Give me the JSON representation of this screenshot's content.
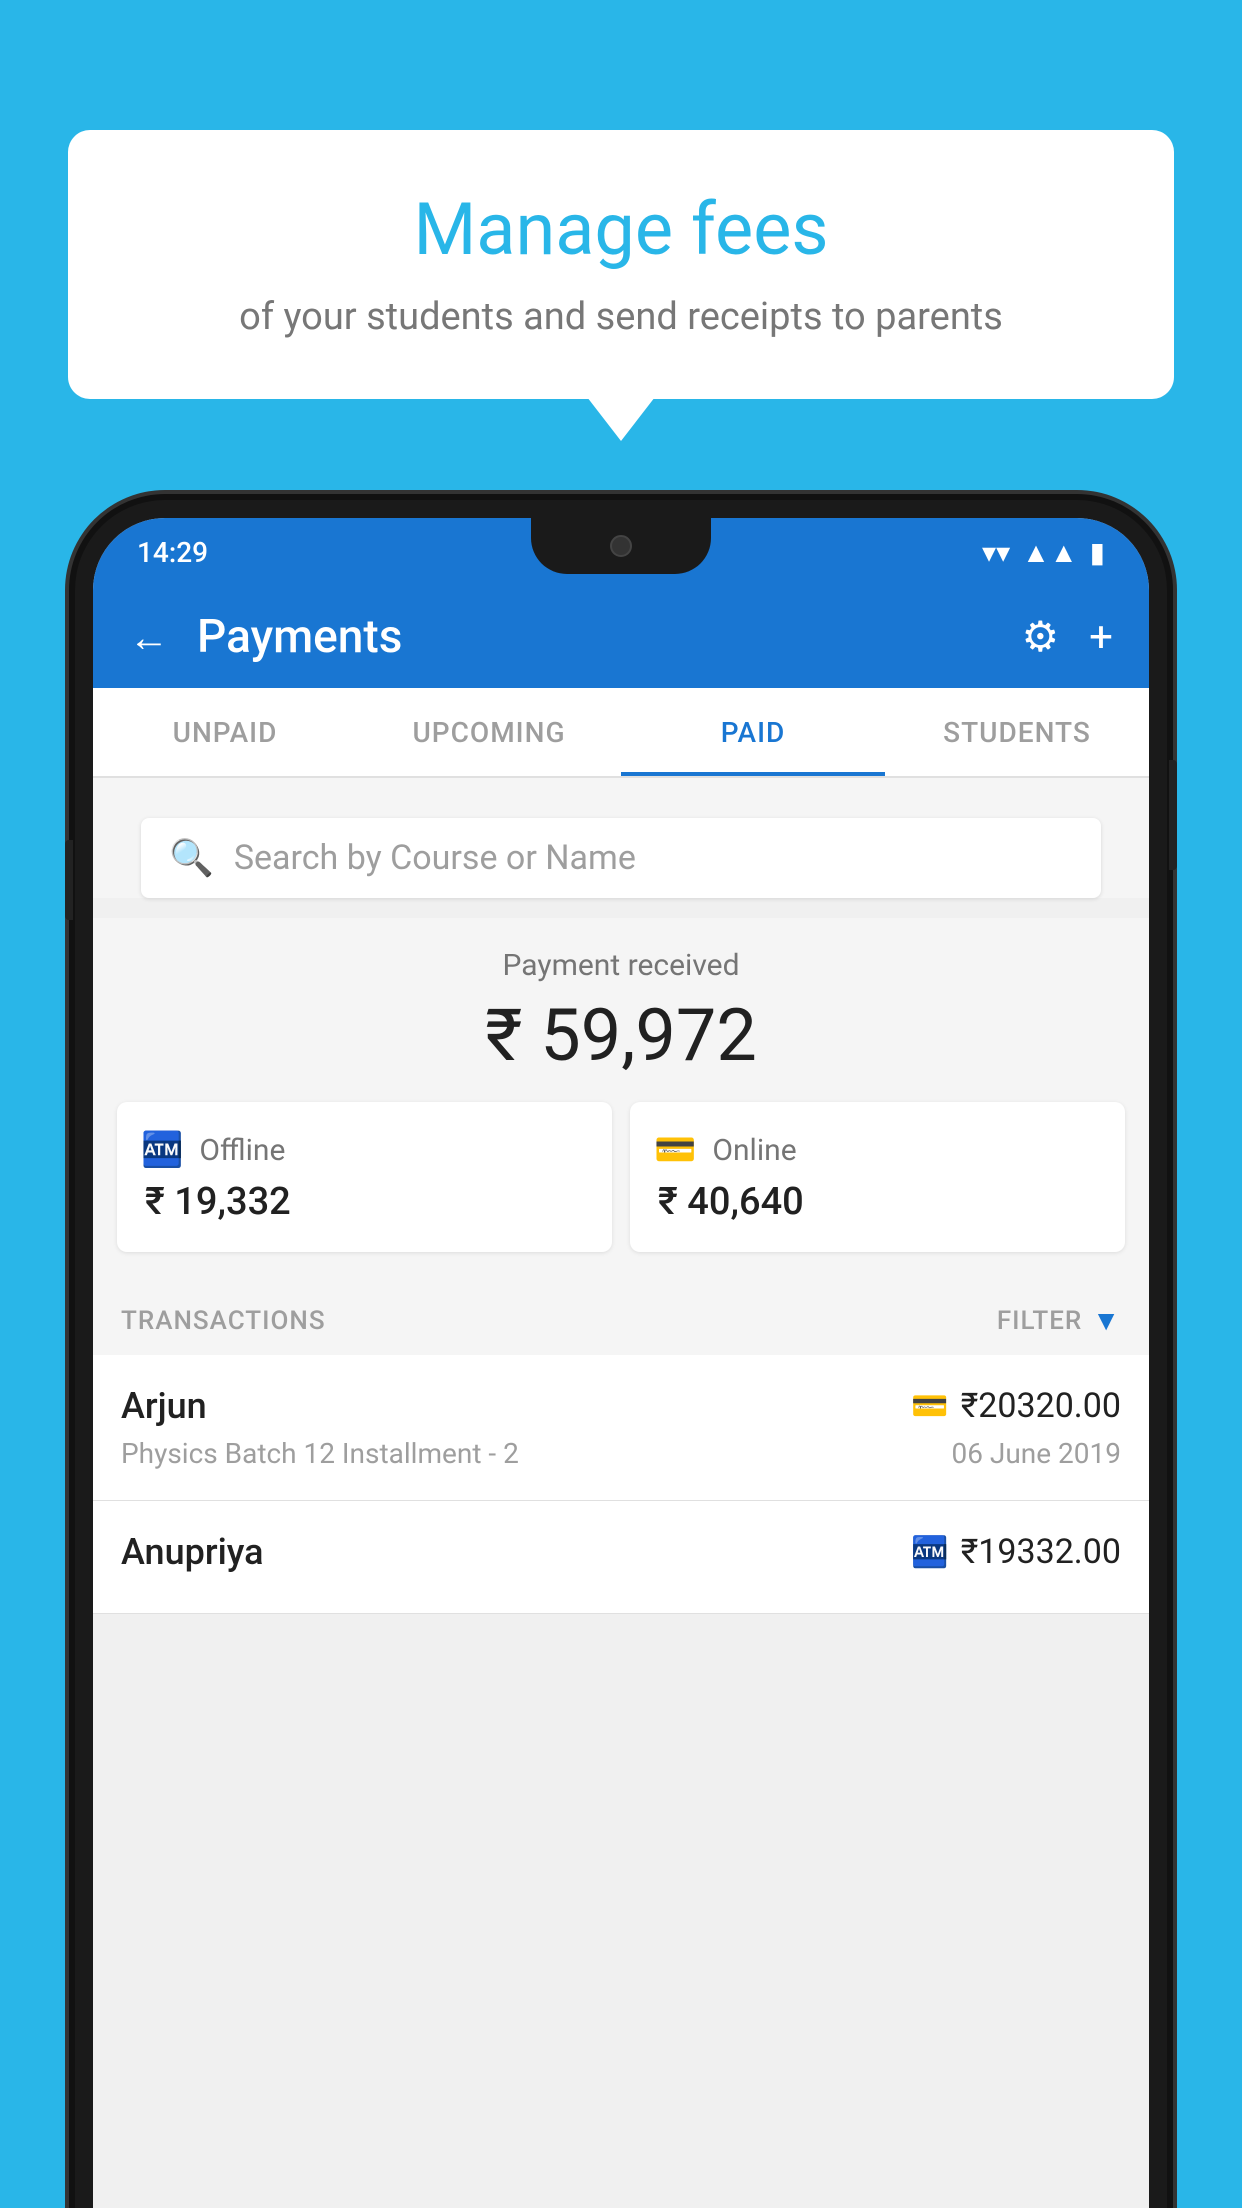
{
  "background_color": "#29b6e8",
  "bubble": {
    "title": "Manage fees",
    "subtitle": "of your students and send receipts to parents"
  },
  "status_bar": {
    "time": "14:29",
    "wifi": "▲",
    "signal": "◀",
    "battery": "▮"
  },
  "header": {
    "title": "Payments",
    "back_label": "←",
    "gear_label": "⚙",
    "plus_label": "+"
  },
  "tabs": [
    {
      "label": "UNPAID",
      "active": false
    },
    {
      "label": "UPCOMING",
      "active": false
    },
    {
      "label": "PAID",
      "active": true
    },
    {
      "label": "STUDENTS",
      "active": false
    }
  ],
  "search": {
    "placeholder": "Search by Course or Name"
  },
  "payment_summary": {
    "received_label": "Payment received",
    "total_amount": "₹ 59,972",
    "offline_label": "Offline",
    "offline_amount": "₹ 19,332",
    "online_label": "Online",
    "online_amount": "₹ 40,640"
  },
  "transactions": {
    "header_label": "TRANSACTIONS",
    "filter_label": "FILTER",
    "rows": [
      {
        "name": "Arjun",
        "detail": "Physics Batch 12 Installment - 2",
        "amount": "₹20320.00",
        "date": "06 June 2019",
        "payment_type": "online"
      },
      {
        "name": "Anupriya",
        "detail": "",
        "amount": "₹19332.00",
        "date": "",
        "payment_type": "offline"
      }
    ]
  },
  "colors": {
    "primary": "#1976d2",
    "accent": "#29b6e8",
    "text_dark": "#212121",
    "text_medium": "#757575",
    "text_light": "#9e9e9e",
    "background": "#f5f5f5",
    "white": "#ffffff"
  }
}
